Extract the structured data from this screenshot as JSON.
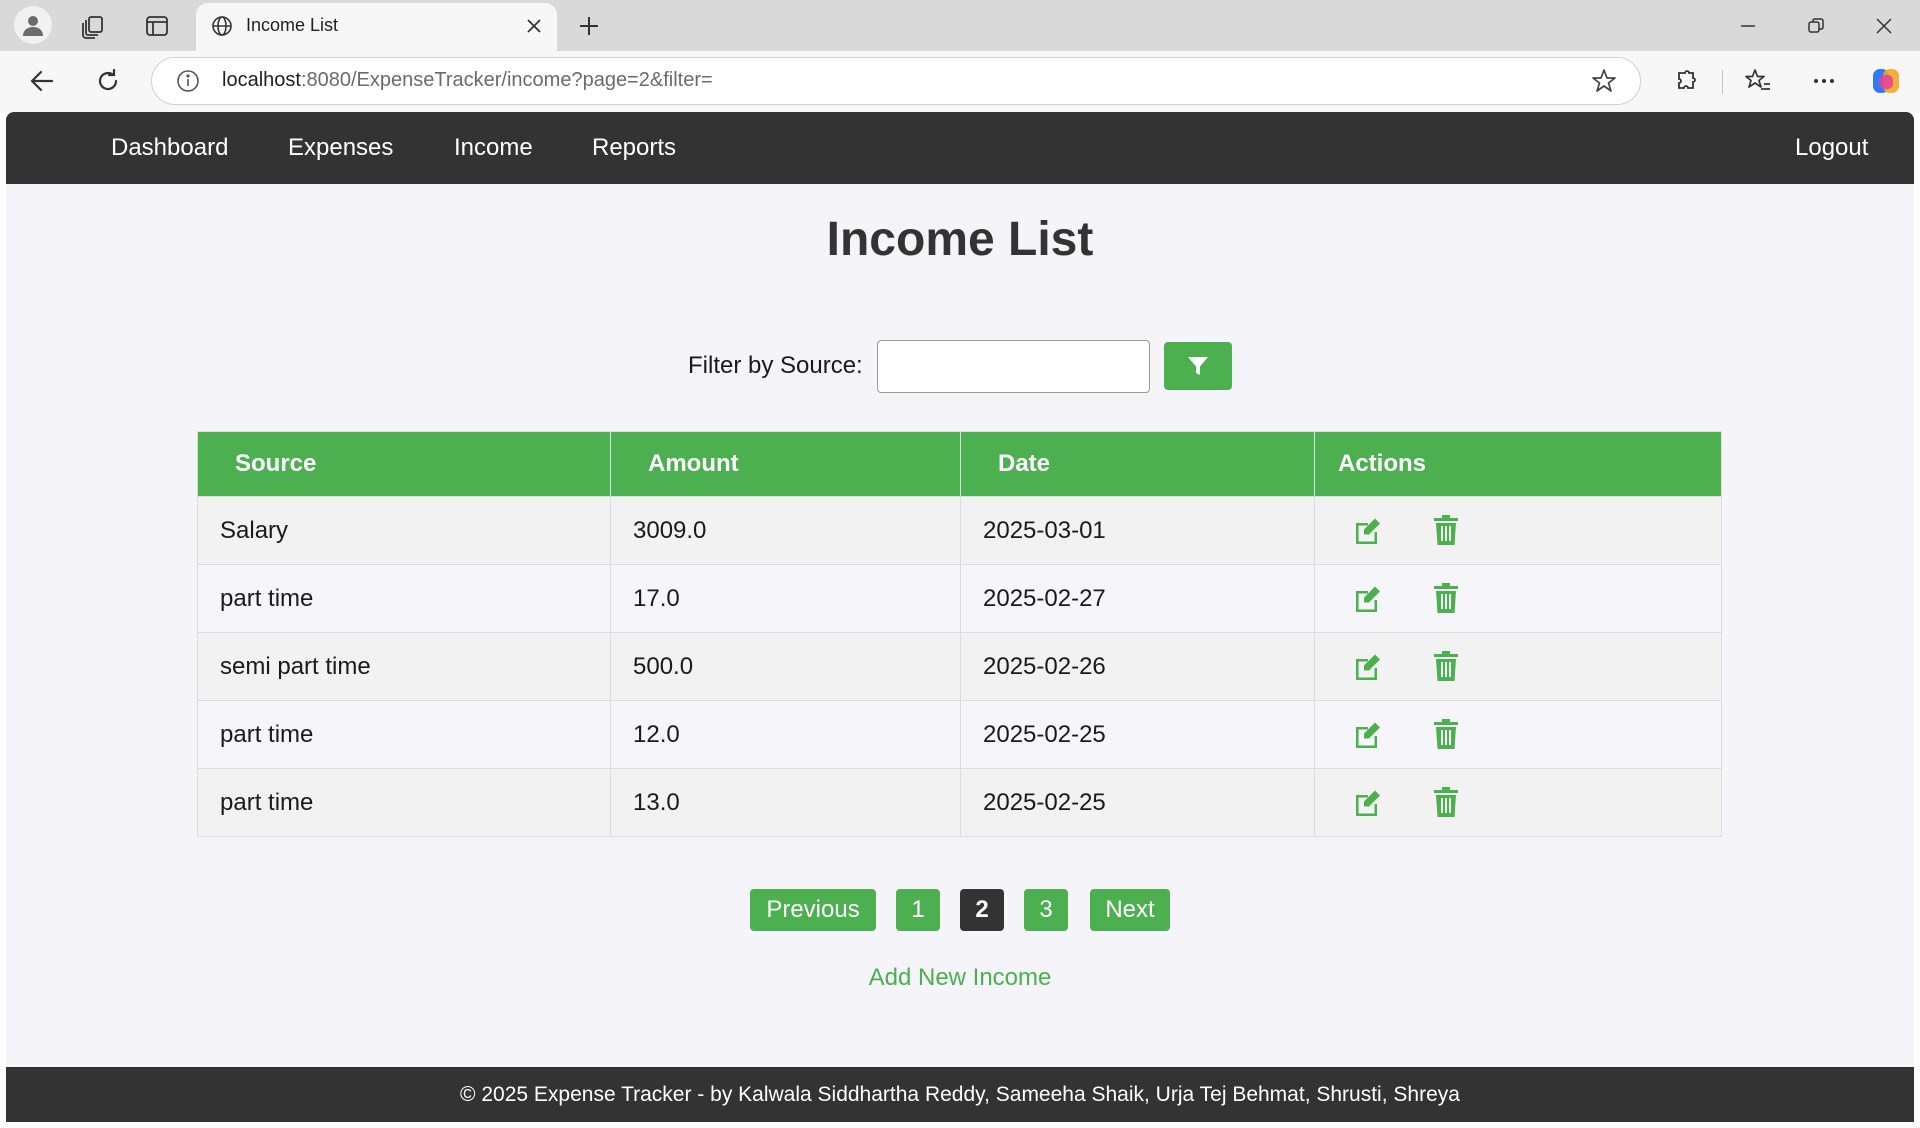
{
  "browser": {
    "tab_title": "Income List",
    "url_host": "localhost",
    "url_rest": ":8080/ExpenseTracker/income?page=2&filter="
  },
  "nav": {
    "links": [
      "Dashboard",
      "Expenses",
      "Income",
      "Reports"
    ],
    "logout": "Logout"
  },
  "page": {
    "title": "Income List"
  },
  "filter": {
    "label": "Filter by Source:",
    "value": "",
    "button_icon": "filter-icon"
  },
  "table": {
    "headers": [
      "Source",
      "Amount",
      "Date",
      "Actions"
    ],
    "rows": [
      {
        "source": "Salary",
        "amount": "3009.0",
        "date": "2025-03-01"
      },
      {
        "source": "part time",
        "amount": "17.0",
        "date": "2025-02-27"
      },
      {
        "source": "semi part time",
        "amount": "500.0",
        "date": "2025-02-26"
      },
      {
        "source": "part time",
        "amount": "12.0",
        "date": "2025-02-25"
      },
      {
        "source": "part time",
        "amount": "13.0",
        "date": "2025-02-25"
      }
    ],
    "action_icons": [
      "edit-icon",
      "trash-icon"
    ]
  },
  "pagination": {
    "previous": "Previous",
    "pages": [
      "1",
      "2",
      "3"
    ],
    "current": "2",
    "next": "Next"
  },
  "add_link": "Add New Income",
  "footer": "© 2025 Expense Tracker - by Kalwala Siddhartha Reddy, Sameeha Shaik, Urja Tej Behmat, Shrusti, Shreya",
  "colors": {
    "accent": "#4caf50",
    "dark": "#333333",
    "page_bg": "#f4f4f9"
  }
}
